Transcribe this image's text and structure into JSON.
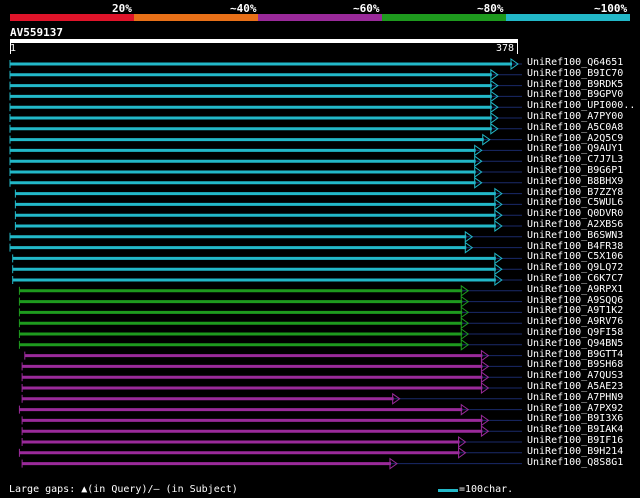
{
  "scale": {
    "labels": [
      "20%",
      "~40%",
      "~60%",
      "~80%",
      "~100%"
    ],
    "colors": [
      "#e0142a",
      "#e87018",
      "#9a2a9a",
      "#1e9a1e",
      "#22b8c8"
    ]
  },
  "query": {
    "name": "AV559137",
    "start": "1",
    "end": "378"
  },
  "hits": [
    {
      "id": "UniRef100_Q64651",
      "qstart": 1,
      "qend": 378,
      "color": "#22b8c8"
    },
    {
      "id": "UniRef100_B9IC70",
      "qstart": 1,
      "qend": 363,
      "color": "#22b8c8"
    },
    {
      "id": "UniRef100_B9RDK5",
      "qstart": 1,
      "qend": 363,
      "color": "#22b8c8"
    },
    {
      "id": "UniRef100_B9GPV0",
      "qstart": 1,
      "qend": 363,
      "color": "#22b8c8"
    },
    {
      "id": "UniRef100_UPI000..",
      "qstart": 1,
      "qend": 363,
      "color": "#22b8c8"
    },
    {
      "id": "UniRef100_A7PY00",
      "qstart": 1,
      "qend": 363,
      "color": "#22b8c8"
    },
    {
      "id": "UniRef100_A5C0A8",
      "qstart": 1,
      "qend": 363,
      "color": "#22b8c8"
    },
    {
      "id": "UniRef100_A2Q5C9",
      "qstart": 1,
      "qend": 357,
      "color": "#22b8c8"
    },
    {
      "id": "UniRef100_Q9AUY1",
      "qstart": 1,
      "qend": 351,
      "color": "#22b8c8"
    },
    {
      "id": "UniRef100_C7J7L3",
      "qstart": 1,
      "qend": 351,
      "color": "#22b8c8"
    },
    {
      "id": "UniRef100_B9G6P1",
      "qstart": 1,
      "qend": 351,
      "color": "#22b8c8"
    },
    {
      "id": "UniRef100_B8BHX9",
      "qstart": 1,
      "qend": 351,
      "color": "#22b8c8"
    },
    {
      "id": "UniRef100_B7ZZY8",
      "qstart": 5,
      "qend": 366,
      "color": "#22b8c8"
    },
    {
      "id": "UniRef100_C5WUL6",
      "qstart": 5,
      "qend": 366,
      "color": "#22b8c8"
    },
    {
      "id": "UniRef100_Q0DVR0",
      "qstart": 5,
      "qend": 366,
      "color": "#22b8c8"
    },
    {
      "id": "UniRef100_A2XBS6",
      "qstart": 5,
      "qend": 366,
      "color": "#22b8c8"
    },
    {
      "id": "UniRef100_B6SWN3",
      "qstart": 1,
      "qend": 344,
      "color": "#22b8c8"
    },
    {
      "id": "UniRef100_B4FR38",
      "qstart": 1,
      "qend": 344,
      "color": "#22b8c8"
    },
    {
      "id": "UniRef100_C5X106",
      "qstart": 3,
      "qend": 366,
      "color": "#22b8c8"
    },
    {
      "id": "UniRef100_Q9LQ72",
      "qstart": 3,
      "qend": 366,
      "color": "#22b8c8"
    },
    {
      "id": "UniRef100_C6K7C7",
      "qstart": 3,
      "qend": 366,
      "color": "#22b8c8"
    },
    {
      "id": "UniRef100_A9RPX1",
      "qstart": 8,
      "qend": 341,
      "color": "#1e9a1e"
    },
    {
      "id": "UniRef100_A9SQQ6",
      "qstart": 8,
      "qend": 341,
      "color": "#1e9a1e"
    },
    {
      "id": "UniRef100_A9T1K2",
      "qstart": 8,
      "qend": 341,
      "color": "#1e9a1e"
    },
    {
      "id": "UniRef100_A9RV76",
      "qstart": 8,
      "qend": 341,
      "color": "#1e9a1e"
    },
    {
      "id": "UniRef100_Q9FI58",
      "qstart": 8,
      "qend": 341,
      "color": "#1e9a1e"
    },
    {
      "id": "UniRef100_Q94BN5",
      "qstart": 8,
      "qend": 341,
      "color": "#1e9a1e"
    },
    {
      "id": "UniRef100_B9GTT4",
      "qstart": 12,
      "qend": 356,
      "color": "#9a2a9a"
    },
    {
      "id": "UniRef100_B9SH68",
      "qstart": 10,
      "qend": 356,
      "color": "#9a2a9a"
    },
    {
      "id": "UniRef100_A7QUS3",
      "qstart": 10,
      "qend": 356,
      "color": "#9a2a9a"
    },
    {
      "id": "UniRef100_A5AE23",
      "qstart": 10,
      "qend": 356,
      "color": "#9a2a9a"
    },
    {
      "id": "UniRef100_A7PHN9",
      "qstart": 10,
      "qend": 290,
      "color": "#9a2a9a"
    },
    {
      "id": "UniRef100_A7PX92",
      "qstart": 8,
      "qend": 341,
      "color": "#9a2a9a"
    },
    {
      "id": "UniRef100_B9I3X6",
      "qstart": 10,
      "qend": 356,
      "color": "#9a2a9a"
    },
    {
      "id": "UniRef100_B9IAK4",
      "qstart": 10,
      "qend": 356,
      "color": "#9a2a9a"
    },
    {
      "id": "UniRef100_B9IF16",
      "qstart": 10,
      "qend": 339,
      "color": "#9a2a9a"
    },
    {
      "id": "UniRef100_B9H214",
      "qstart": 8,
      "qend": 339,
      "color": "#9a2a9a"
    },
    {
      "id": "UniRef100_Q8S8G1",
      "qstart": 10,
      "qend": 288,
      "color": "#9a2a9a"
    }
  ],
  "legend": {
    "gaps_text": "Large gaps: ▲(in Query)/– (in Subject)",
    "scale_text": "=100char."
  }
}
